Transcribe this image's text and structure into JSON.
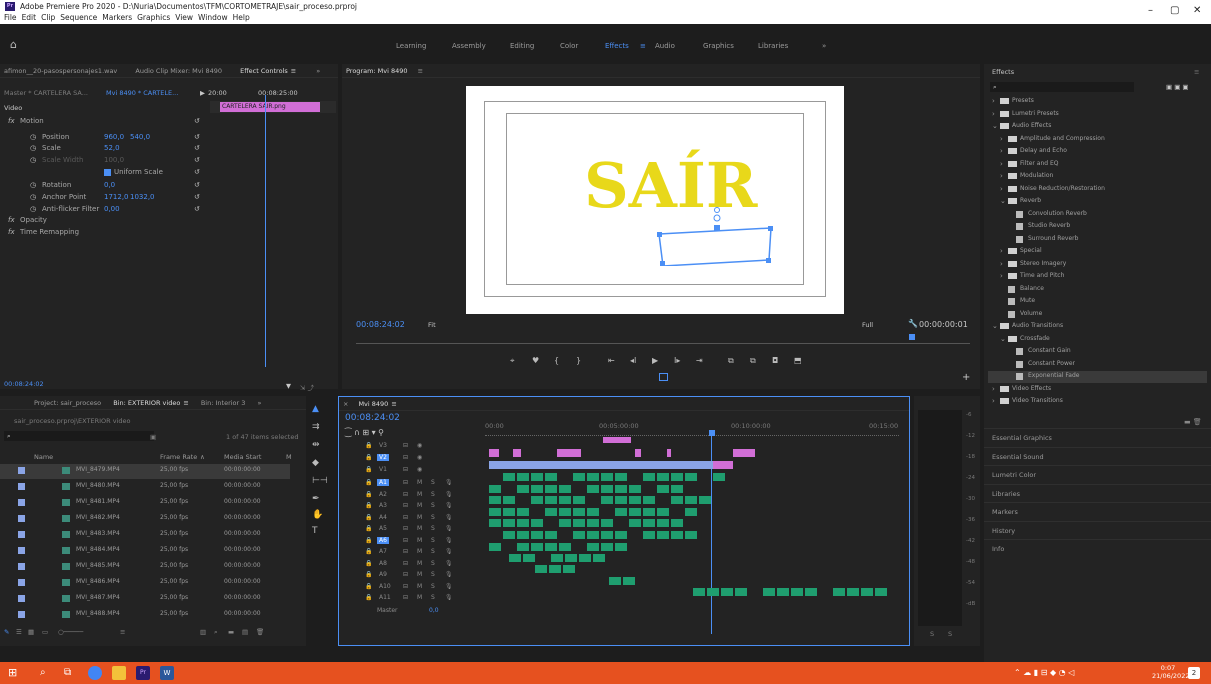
{
  "window": {
    "title": "Adobe Premiere Pro 2020 - D:\\Nuria\\Documentos\\TFM\\CORTOMETRAJE\\sair_proceso.prproj",
    "app_icon": "Pr",
    "menu": [
      "File",
      "Edit",
      "Clip",
      "Sequence",
      "Markers",
      "Graphics",
      "View",
      "Window",
      "Help"
    ],
    "controls": {
      "minimize": "–",
      "maximize": "▢",
      "close": "✕"
    }
  },
  "workspaces": {
    "items": [
      "Learning",
      "Assembly",
      "Editing",
      "Color",
      "Effects",
      "Audio",
      "Graphics",
      "Libraries"
    ],
    "active": "Effects",
    "more": "»",
    "menu_icon": "≡"
  },
  "left_top_tabs": {
    "source": "afimon__20-pasospersonajes1.wav",
    "mixer": "Audio Clip Mixer: Mvi 8490",
    "effect_controls": "Effect Controls",
    "menu_icon": "≡",
    "more": "»"
  },
  "effect_controls": {
    "master": "Master * CARTELERA SA...",
    "clip": "Mvi 8490 * CARTELE...",
    "play": "▶",
    "ruler_start": "20:00",
    "ruler_mid": "00:08:25:00",
    "clip_label": "CARTELERA SAIR.png",
    "video_header": "Video",
    "timecode": "00:08:24:02",
    "props": [
      {
        "label": "Motion",
        "fx": "fx"
      },
      {
        "label": "Position",
        "v1": "960,0",
        "v2": "540,0"
      },
      {
        "label": "Scale",
        "v1": "52,0"
      },
      {
        "label": "Scale Width",
        "v1": "100,0"
      },
      {
        "label": "Uniform Scale"
      },
      {
        "label": "Rotation",
        "v1": "0,0"
      },
      {
        "label": "Anchor Point",
        "v1": "1712,0",
        "v2": "1032,0"
      },
      {
        "label": "Anti-flicker Filter",
        "v1": "0,00"
      },
      {
        "label": "Opacity",
        "fx": "fx"
      },
      {
        "label": "Time Remapping",
        "fx": "fx"
      }
    ]
  },
  "program": {
    "title": "Program: Mvi 8490",
    "menu_icon": "≡",
    "timecode": "00:08:24:02",
    "fit": "Fit",
    "quality": "Full",
    "duration": "00:00:00:01",
    "title_text": "SAÍR",
    "title_color": "#e8d81a",
    "transport": [
      "⌖",
      "♥",
      "{",
      "}",
      "⇤",
      "◂I",
      "▶",
      "I▸",
      "⇥",
      "⧉",
      "⧉",
      "◘",
      "⬒"
    ],
    "add": "+"
  },
  "project": {
    "tabs": [
      "Project: sair_proceso",
      "Bin: EXTERIOR video",
      "Bin: Interior 3"
    ],
    "menu_icon": "≡",
    "more": "»",
    "path": "sair_proceso.prproj\\EXTERIOR video",
    "count": "1 of 47 items selected",
    "columns": [
      "Name",
      "Frame Rate",
      "Media Start",
      "M"
    ],
    "sort_icon": "∧",
    "rows": [
      {
        "name": "MVI_8479.MP4",
        "fps": "25,00 fps",
        "start": "00:00:00:00"
      },
      {
        "name": "MVI_8480.MP4",
        "fps": "25,00 fps",
        "start": "00:00:00:00"
      },
      {
        "name": "MVI_8481.MP4",
        "fps": "25,00 fps",
        "start": "00:00:00:00"
      },
      {
        "name": "MVI_8482.MP4",
        "fps": "25,00 fps",
        "start": "00:00:00:00"
      },
      {
        "name": "MVI_8483.MP4",
        "fps": "25,00 fps",
        "start": "00:00:00:00"
      },
      {
        "name": "MVI_8484.MP4",
        "fps": "25,00 fps",
        "start": "00:00:00:00"
      },
      {
        "name": "MVI_8485.MP4",
        "fps": "25,00 fps",
        "start": "00:00:00:00"
      },
      {
        "name": "MVI_8486.MP4",
        "fps": "25,00 fps",
        "start": "00:00:00:00"
      },
      {
        "name": "MVI_8487.MP4",
        "fps": "25,00 fps",
        "start": "00:00:00:00"
      },
      {
        "name": "MVI_8488.MP4",
        "fps": "25,00 fps",
        "start": "00:00:00:00"
      }
    ]
  },
  "timeline": {
    "tab": "Mvi 8490",
    "menu_icon": "≡",
    "timecode": "00:08:24:02",
    "ruler": [
      "00:00",
      "00:05:00:00",
      "00:10:00:00",
      "00:15:00"
    ],
    "video_tracks": [
      "V3",
      "V2",
      "V1"
    ],
    "audio_tracks": [
      "A1",
      "A2",
      "A3",
      "A4",
      "A5",
      "A6",
      "A7",
      "A8",
      "A9",
      "A10",
      "A11"
    ],
    "master": "Master",
    "master_val": "0,0",
    "track_btns": [
      "M",
      "S"
    ],
    "meter_labels": [
      "-6",
      "-12",
      "-18",
      "-24",
      "-30",
      "-36",
      "-42",
      "-48",
      "-54",
      "-dB"
    ],
    "meter_bottom": [
      "S",
      "S"
    ]
  },
  "effects": {
    "title": "Effects",
    "menu_icon": "≡",
    "tree": [
      {
        "label": "Presets",
        "lvl": 0,
        "kind": "folder",
        "open": false
      },
      {
        "label": "Lumetri Presets",
        "lvl": 0,
        "kind": "folder",
        "open": false
      },
      {
        "label": "Audio Effects",
        "lvl": 0,
        "kind": "folder",
        "open": true
      },
      {
        "label": "Amplitude and Compression",
        "lvl": 1,
        "kind": "folder",
        "open": false
      },
      {
        "label": "Delay and Echo",
        "lvl": 1,
        "kind": "folder",
        "open": false
      },
      {
        "label": "Filter and EQ",
        "lvl": 1,
        "kind": "folder",
        "open": false
      },
      {
        "label": "Modulation",
        "lvl": 1,
        "kind": "folder",
        "open": false
      },
      {
        "label": "Noise Reduction/Restoration",
        "lvl": 1,
        "kind": "folder",
        "open": false
      },
      {
        "label": "Reverb",
        "lvl": 1,
        "kind": "folder",
        "open": true
      },
      {
        "label": "Convolution Reverb",
        "lvl": 2,
        "kind": "fx"
      },
      {
        "label": "Studio Reverb",
        "lvl": 2,
        "kind": "fx"
      },
      {
        "label": "Surround Reverb",
        "lvl": 2,
        "kind": "fx"
      },
      {
        "label": "Special",
        "lvl": 1,
        "kind": "folder",
        "open": false
      },
      {
        "label": "Stereo Imagery",
        "lvl": 1,
        "kind": "folder",
        "open": false
      },
      {
        "label": "Time and Pitch",
        "lvl": 1,
        "kind": "folder",
        "open": false
      },
      {
        "label": "Balance",
        "lvl": 1,
        "kind": "fx"
      },
      {
        "label": "Mute",
        "lvl": 1,
        "kind": "fx"
      },
      {
        "label": "Volume",
        "lvl": 1,
        "kind": "fx"
      },
      {
        "label": "Audio Transitions",
        "lvl": 0,
        "kind": "folder",
        "open": true
      },
      {
        "label": "Crossfade",
        "lvl": 1,
        "kind": "folder",
        "open": true
      },
      {
        "label": "Constant Gain",
        "lvl": 2,
        "kind": "tr"
      },
      {
        "label": "Constant Power",
        "lvl": 2,
        "kind": "tr"
      },
      {
        "label": "Exponential Fade",
        "lvl": 2,
        "kind": "tr",
        "selected": true
      },
      {
        "label": "Video Effects",
        "lvl": 0,
        "kind": "folder",
        "open": false
      },
      {
        "label": "Video Transitions",
        "lvl": 0,
        "kind": "folder",
        "open": false
      }
    ],
    "sections": [
      "Essential Graphics",
      "Essential Sound",
      "Lumetri Color",
      "Libraries",
      "Markers",
      "History",
      "Info"
    ]
  },
  "taskbar": {
    "time": "0:07",
    "date": "21/06/2022"
  },
  "colors": {
    "accent": "#4b8ff5",
    "taskbar": "#e6511f",
    "clip_green": "#1f9e6f",
    "clip_pink": "#d16ed6",
    "clip_blue": "#8aa4e6"
  }
}
